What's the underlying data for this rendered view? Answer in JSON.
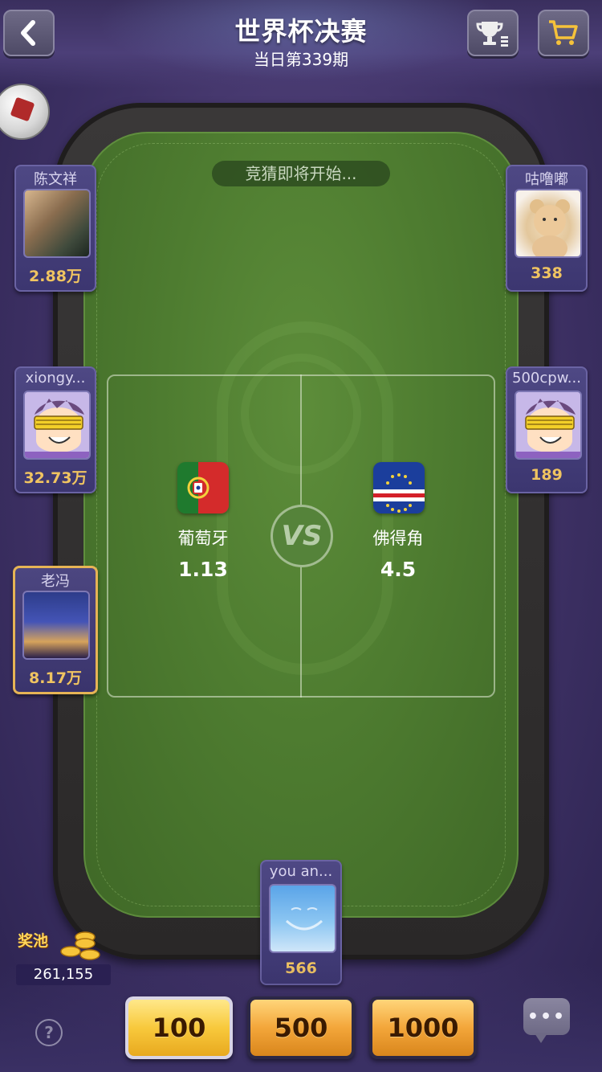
{
  "header": {
    "title": "世界杯决赛",
    "subtitle": "当日第339期"
  },
  "status": "竞猜即将开始...",
  "match": {
    "vs_label": "VS",
    "home": {
      "name": "葡萄牙",
      "odds": "1.13",
      "flag": "portugal-flag-icon"
    },
    "away": {
      "name": "佛得角",
      "odds": "4.5",
      "flag": "cape-verde-flag-icon"
    }
  },
  "players": {
    "left": [
      {
        "name": "陈文祥",
        "score": "2.88万",
        "avatar": "dog-photo"
      },
      {
        "name": "xiongy...",
        "score": "32.73万",
        "avatar": "cartoon-sunglasses"
      },
      {
        "name": "老冯",
        "score": "8.17万",
        "avatar": "city-skyline"
      }
    ],
    "right": [
      {
        "name": "咕噜嘟",
        "score": "338",
        "avatar": "teddy-bear"
      },
      {
        "name": "500cpw...",
        "score": "189",
        "avatar": "cartoon-sunglasses"
      }
    ],
    "me": {
      "name": "you an...",
      "score": "566",
      "avatar": "sky-face"
    }
  },
  "pool": {
    "label": "奖池",
    "value": "261,155"
  },
  "chips": [
    "100",
    "500",
    "1000"
  ],
  "help_label": "?",
  "chat_label": "•••",
  "colors": {
    "felt": "#4e7c30",
    "score_gold": "#f0c461",
    "seat_bg": "#4e4884",
    "active_border": "#e6b455"
  }
}
